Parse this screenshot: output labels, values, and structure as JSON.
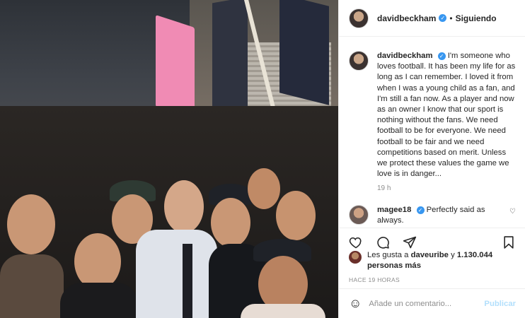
{
  "post": {
    "author": "davidbeckham",
    "follow_status": "Siguiendo",
    "separator": "•",
    "caption": "I'm someone who loves football. It has been my life for as long as I can remember. I loved it from when I was a young child as a fan, and I'm still a fan now. As a player and now as an owner I know that our sport is nothing without the fans. We need football to be for everyone. We need football to be fair and we need competitions based on merit. Unless we protect these values the game we love is in danger...",
    "caption_time": "19 h"
  },
  "comments": [
    {
      "user": "magee18",
      "text": "Perfectly said as always."
    }
  ],
  "likes": {
    "prefix": "Les gusta a",
    "first_user": "daveuribe",
    "joiner": "y",
    "count": "1.130.044 personas más"
  },
  "posted_ago": "HACE 19 HORAS",
  "add_comment": {
    "placeholder": "Añade un comentario...",
    "publish_label": "Publicar"
  },
  "icons": {
    "verified": "verified-badge-icon",
    "like": "heart-icon",
    "comment": "comment-icon",
    "share": "paper-plane-icon",
    "save": "bookmark-icon",
    "emoji": "emoji-icon"
  },
  "colors": {
    "accent": "#3897f0",
    "publish_disabled": "#b2dffc",
    "muted": "#8e8e8e"
  }
}
